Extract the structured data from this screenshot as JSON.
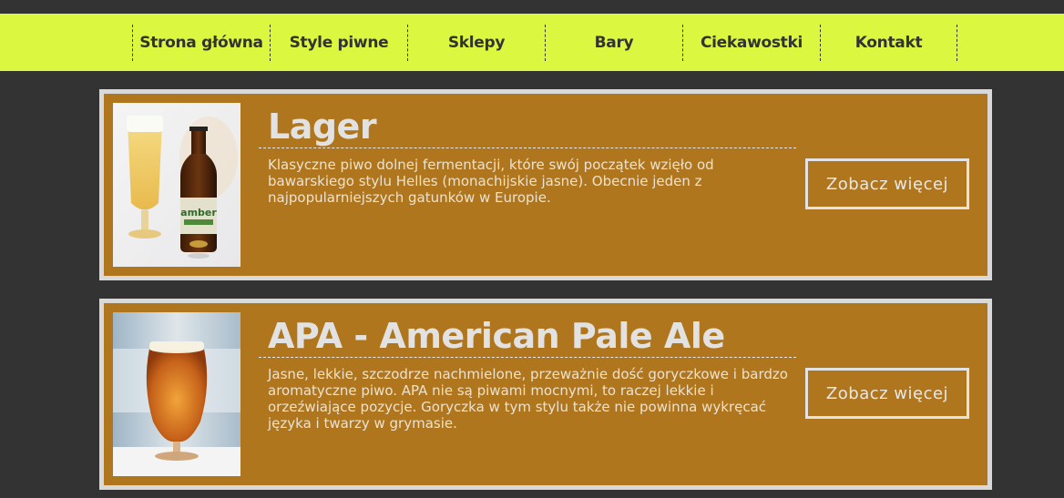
{
  "nav": {
    "items": [
      {
        "label": "Strona główna"
      },
      {
        "label": "Style piwne"
      },
      {
        "label": "Sklepy"
      },
      {
        "label": "Bary"
      },
      {
        "label": "Ciekawostki"
      },
      {
        "label": "Kontakt"
      }
    ]
  },
  "colors": {
    "nav_bg": "#dbf740",
    "page_bg": "#333333",
    "card_bg": "#b0761e",
    "card_border": "#d9d9d9"
  },
  "beers": [
    {
      "title": "Lager",
      "description": "Klasyczne piwo dolnej fermentacji, które swój początek wzięło od bawarskiego stylu Helles (monachijskie jasne). Obecnie jeden z najpopularniejszych gatunków w Europie.",
      "button": "Zobacz więcej",
      "bottle_label": "amber"
    },
    {
      "title": "APA - American Pale Ale",
      "description": "Jasne, lekkie, szczodrze nachmielone, przeważnie dość goryczkowe i bardzo aromatyczne piwo. APA nie są piwami mocnymi, to raczej lekkie i orzeźwiające pozycje. Goryczka w tym stylu także nie powinna wykręcać języka i twarzy w grymasie.",
      "button": "Zobacz więcej"
    }
  ]
}
